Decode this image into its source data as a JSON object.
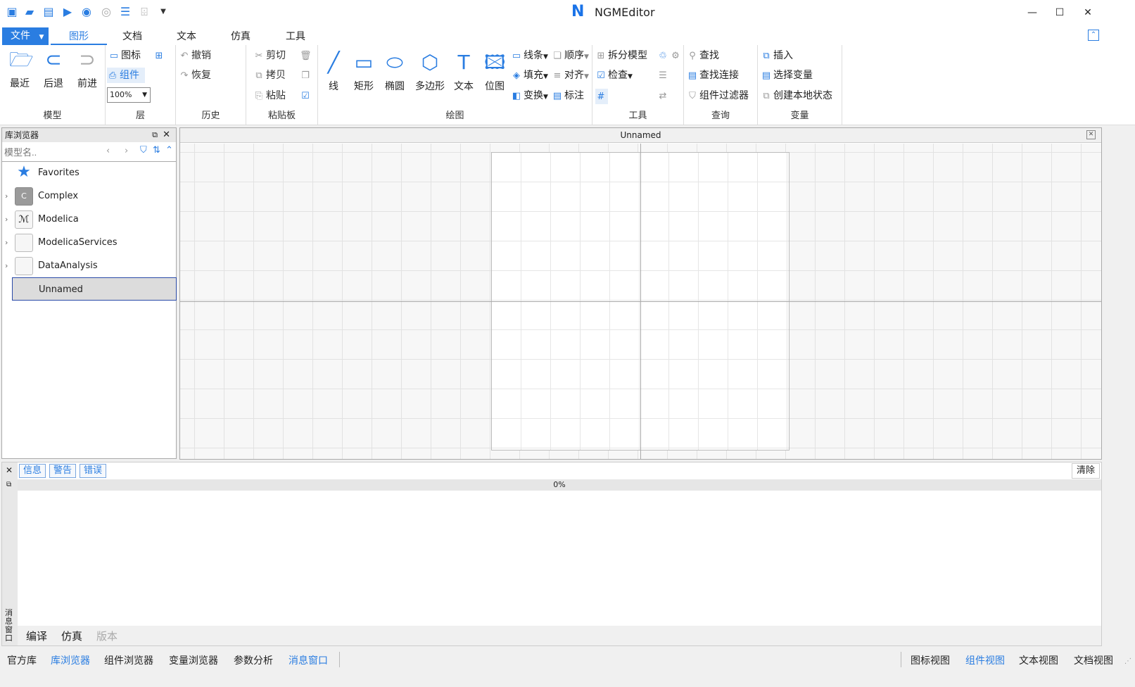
{
  "app": {
    "title": "NGMEditor"
  },
  "menu": {
    "file": "文件",
    "tabs": [
      "图形",
      "文档",
      "文本",
      "仿真",
      "工具"
    ]
  },
  "ribbon": {
    "model": {
      "label": "模型",
      "recent": "最近",
      "back": "后退",
      "forward": "前进"
    },
    "layer": {
      "label": "层",
      "icon": "图标",
      "component": "组件",
      "zoom": "100%"
    },
    "history": {
      "label": "历史",
      "undo": "撤销",
      "redo": "恢复"
    },
    "clipboard": {
      "label": "粘贴板",
      "cut": "剪切",
      "copy": "拷贝",
      "paste": "粘贴"
    },
    "draw": {
      "label": "绘图",
      "line": "线",
      "rect": "矩形",
      "ellipse": "椭圆",
      "polygon": "多边形",
      "text": "文本",
      "bitmap": "位图",
      "stroke": "线条",
      "fill": "填充",
      "transform": "变换",
      "order": "顺序",
      "align": "对齐",
      "annotate": "标注"
    },
    "tools": {
      "label": "工具",
      "split": "拆分模型",
      "check": "检查"
    },
    "query": {
      "label": "查询",
      "find": "查找",
      "find_conn": "查找连接",
      "comp_filter": "组件过滤器"
    },
    "variable": {
      "label": "变量",
      "insert": "插入",
      "select_var": "选择变量",
      "create_local": "创建本地状态"
    }
  },
  "library": {
    "title": "库浏览器",
    "search_placeholder": "模型名..",
    "items": [
      {
        "label": "Favorites",
        "icon": "star-icon"
      },
      {
        "label": "Complex",
        "icon": "complex-icon",
        "badge": "C"
      },
      {
        "label": "Modelica",
        "icon": "modelica-icon"
      },
      {
        "label": "ModelicaServices",
        "icon": "package-icon"
      },
      {
        "label": "DataAnalysis",
        "icon": "package-icon"
      },
      {
        "label": "Unnamed",
        "icon": "model-icon"
      }
    ]
  },
  "canvas": {
    "title": "Unnamed"
  },
  "messages": {
    "tabs": [
      "信息",
      "警告",
      "错误"
    ],
    "clear": "清除",
    "progress": "0%",
    "side_label": "消息窗口",
    "bottom_tabs": [
      "编译",
      "仿真",
      "版本"
    ]
  },
  "status": {
    "left": [
      "官方库",
      "库浏览器",
      "组件浏览器",
      "变量浏览器",
      "参数分析",
      "消息窗口"
    ],
    "right": [
      "图标视图",
      "组件视图",
      "文本视图",
      "文档视图"
    ]
  }
}
